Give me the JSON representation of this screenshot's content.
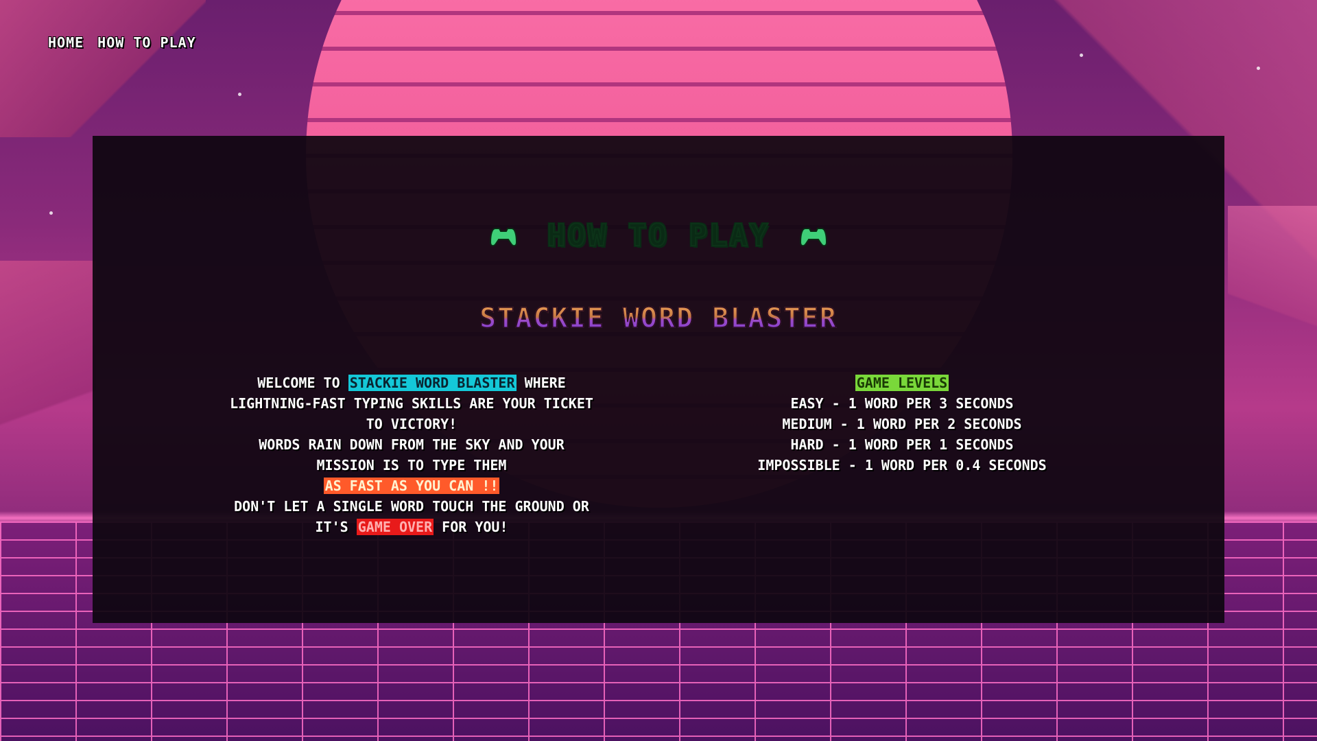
{
  "nav": {
    "home": "HOME",
    "how_to_play": "HOW TO PLAY"
  },
  "panel": {
    "title": "HOW TO PLAY",
    "subtitle": "STACKIE WORD BLASTER",
    "intro": {
      "welcome": "WELCOME TO",
      "game_name": "STACKIE WORD BLASTER",
      "where": "WHERE",
      "line2": "LIGHTNING-FAST TYPING SKILLS ARE YOUR TICKET",
      "line3": "TO VICTORY!",
      "line4": "WORDS RAIN DOWN FROM THE SKY  AND YOUR",
      "line5": "MISSION IS TO TYPE THEM",
      "fast": "AS FAST AS YOU CAN !!",
      "line7": "DON'T LET A SINGLE WORD TOUCH THE GROUND  OR",
      "its": "IT'S",
      "game_over": "GAME OVER",
      "for_you": "FOR YOU!"
    },
    "levels": {
      "heading": "GAME LEVELS",
      "items": [
        "EASY - 1 WORD PER 3 SECONDS",
        "MEDIUM - 1 WORD PER 2 SECONDS",
        "HARD - 1 WORD PER 1 SECONDS",
        "IMPOSSIBLE - 1 WORD PER 0.4 SECONDS"
      ]
    }
  },
  "icons": {
    "left": "gamepad-icon",
    "right": "gamepad-icon"
  },
  "colors": {
    "title": "#44e07a",
    "game_name_highlight": "#14c8d8",
    "fast_highlight": "#ff5a2a",
    "game_over_highlight": "#e81a1a",
    "levels_highlight": "#7ad83a"
  }
}
